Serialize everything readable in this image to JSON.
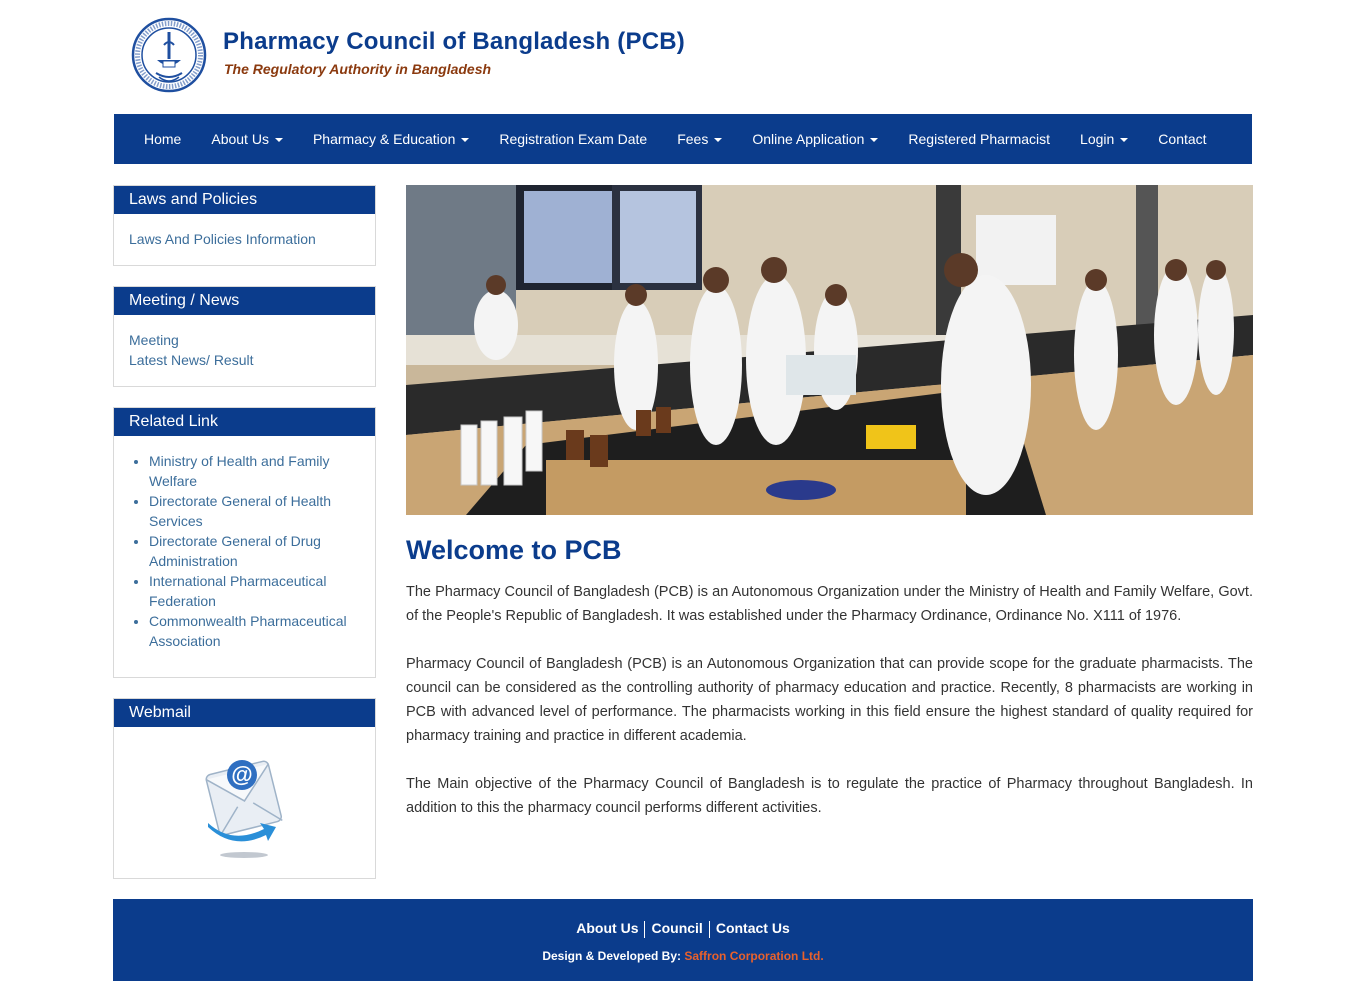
{
  "header": {
    "title": "Pharmacy Council of Bangladesh (PCB)",
    "tagline": "The Regulatory Authority in Bangladesh"
  },
  "nav": {
    "items": [
      {
        "label": "Home",
        "dropdown": false
      },
      {
        "label": "About Us",
        "dropdown": true
      },
      {
        "label": "Pharmacy & Education",
        "dropdown": true
      },
      {
        "label": "Registration Exam Date",
        "dropdown": false
      },
      {
        "label": "Fees",
        "dropdown": true
      },
      {
        "label": "Online Application",
        "dropdown": true
      },
      {
        "label": "Registered Pharmacist",
        "dropdown": false
      },
      {
        "label": "Login",
        "dropdown": true
      },
      {
        "label": "Contact",
        "dropdown": false
      }
    ]
  },
  "sidebar": {
    "laws": {
      "heading": "Laws and Policies",
      "links": [
        "Laws And Policies Information"
      ]
    },
    "meeting": {
      "heading": "Meeting / News",
      "links": [
        "Meeting",
        "Latest News/ Result"
      ]
    },
    "related": {
      "heading": "Related Link",
      "links": [
        "Ministry of Health and Family Welfare",
        "Directorate General of Health Services",
        "Directorate General of Drug Administration",
        "International Pharmaceutical Federation",
        "Commonwealth Pharmaceutical Association"
      ]
    },
    "webmail": {
      "heading": "Webmail",
      "icon": "email-at-icon"
    }
  },
  "main": {
    "title": "Welcome to PCB",
    "paragraphs": [
      "The Pharmacy Council of Bangladesh (PCB) is an Autonomous Organization under the Ministry of Health and Family Welfare, Govt. of the People's Republic of Bangladesh. It was established under the Pharmacy Ordinance, Ordinance No. X111 of 1976.",
      "Pharmacy Council of Bangladesh (PCB) is an Autonomous Organization that can provide scope for the graduate pharmacists. The council can be considered as the controlling authority of pharmacy education and practice. Recently, 8 pharmacists are working in PCB with advanced level of performance. The pharmacists working in this field ensure the highest standard of quality required for pharmacy training and practice in different academia.",
      "The Main objective of the Pharmacy Council of Bangladesh is to regulate the practice of Pharmacy throughout Bangladesh. In addition to this the pharmacy council performs different activities."
    ]
  },
  "footer": {
    "links": [
      "About Us",
      "Council",
      "Contact Us"
    ],
    "credit_label": "Design & Developed By:",
    "credit_company": "Saffron Corporation Ltd."
  },
  "colors": {
    "brand_blue": "#0b3c8c",
    "tagline_brown": "#8b3a0f",
    "link_blue": "#3c6e9b",
    "credit_orange": "#e8612c"
  }
}
